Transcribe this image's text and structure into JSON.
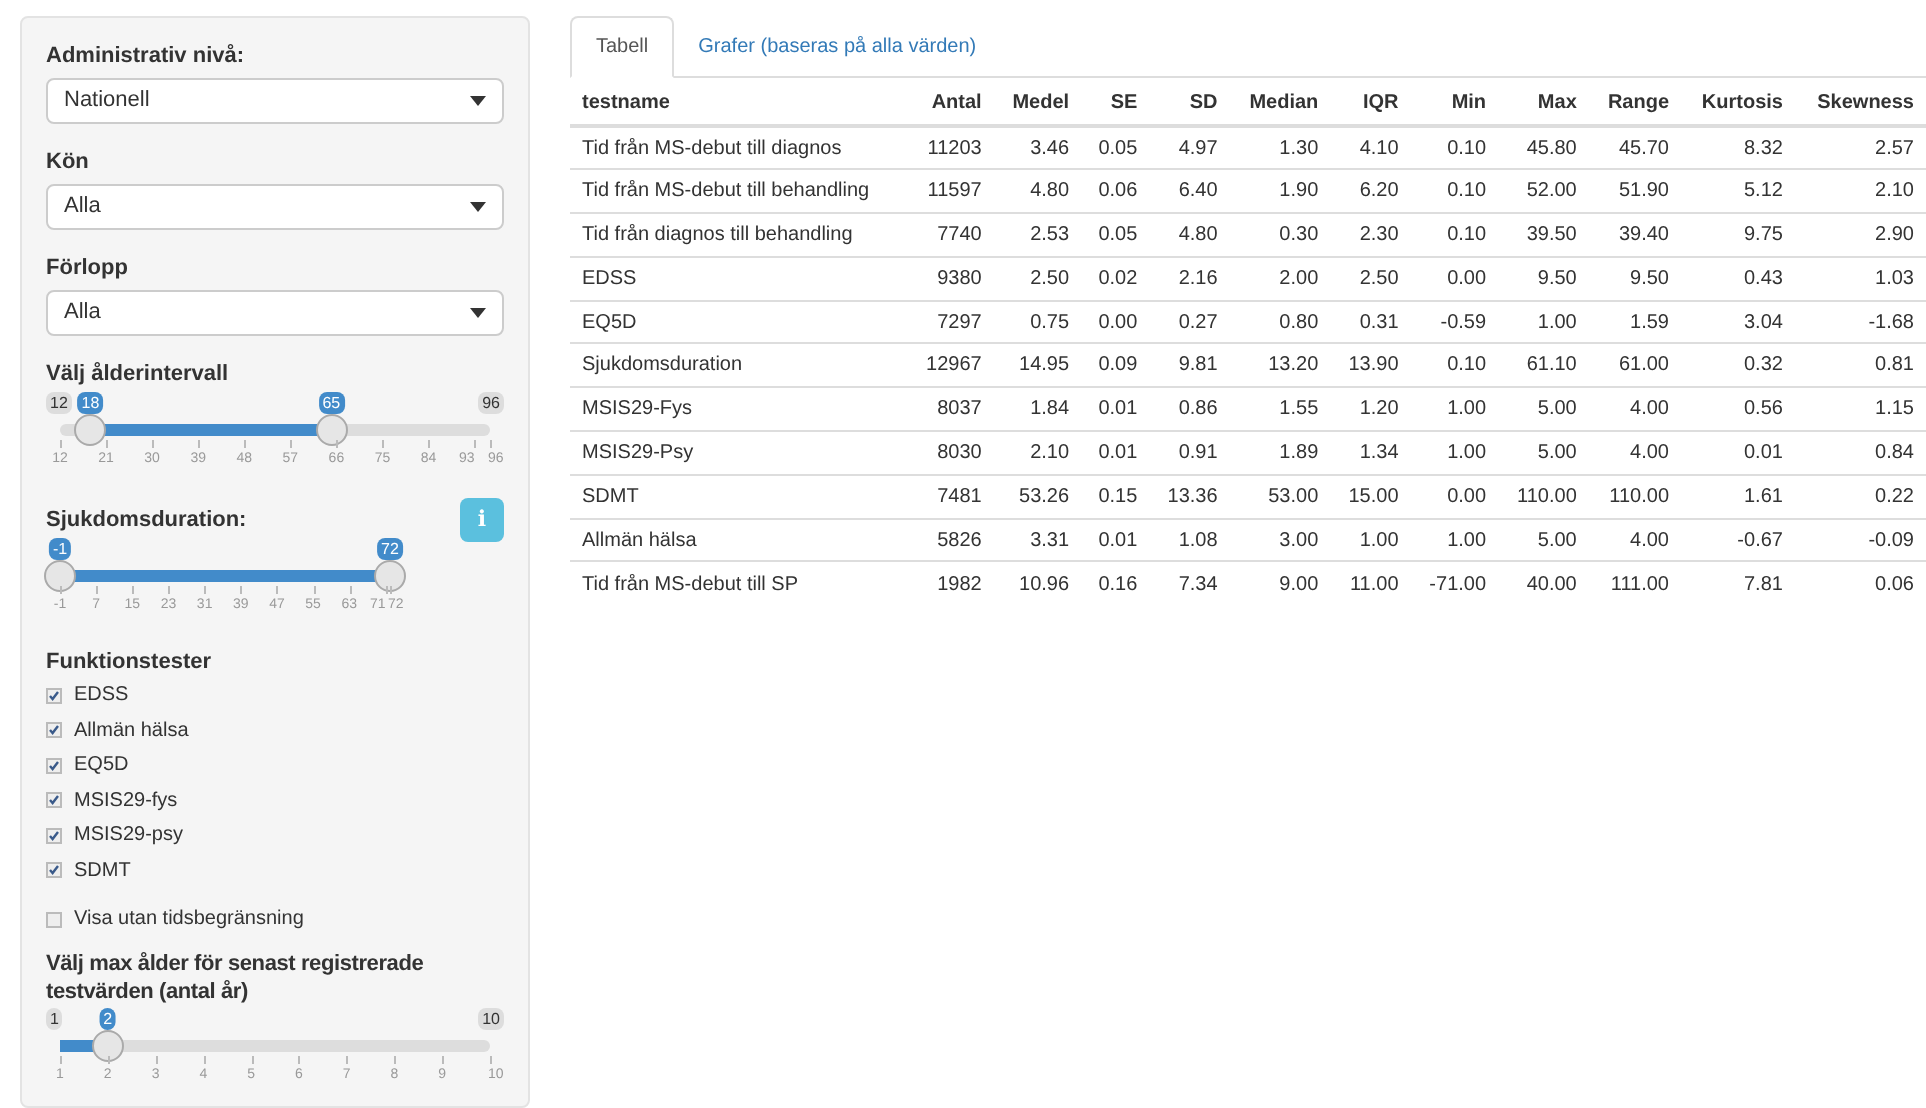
{
  "sidebar": {
    "selects": [
      {
        "label": "Administrativ nivå:",
        "value": "Nationell"
      },
      {
        "label": "Kön",
        "value": "Alla"
      },
      {
        "label": "Förlopp",
        "value": "Alla"
      }
    ],
    "age_slider": {
      "label": "Välj ålderintervall",
      "min": "12",
      "max": "96",
      "thumbs": [
        {
          "value": "18",
          "level": 0.071
        },
        {
          "value": "65",
          "level": 0.631
        }
      ],
      "ticks": [
        "12",
        "21",
        "30",
        "39",
        "48",
        "57",
        "66",
        "75",
        "84",
        "93",
        "96"
      ]
    },
    "duration_slider": {
      "label": "Sjukdomsduration:",
      "thumbs": [
        {
          "value": "-1",
          "level": 0
        },
        {
          "value": "72",
          "level": 1
        }
      ],
      "ticks": [
        "-1",
        "7",
        "15",
        "23",
        "31",
        "39",
        "47",
        "55",
        "63",
        "71",
        "72"
      ]
    },
    "info_button": {
      "label": "i"
    },
    "checks_title": "Funktionstester",
    "checks": [
      {
        "label": "EDSS",
        "checked": true
      },
      {
        "label": "Allmän hälsa",
        "checked": true
      },
      {
        "label": "EQ5D",
        "checked": true
      },
      {
        "label": "MSIS29-fys",
        "checked": true
      },
      {
        "label": "MSIS29-psy",
        "checked": true
      },
      {
        "label": "SDMT",
        "checked": true
      }
    ],
    "no_time_limit": {
      "label": "Visa utan tidsbegränsning",
      "checked": false
    },
    "max_age_slider": {
      "label": "Välj max ålder för senast registrerade testvärden (antal år)",
      "min": "1",
      "max": "10",
      "thumbs": [
        {
          "value": "2",
          "level": 0.111
        }
      ],
      "ticks": [
        "1",
        "2",
        "3",
        "4",
        "5",
        "6",
        "7",
        "8",
        "9",
        "10"
      ]
    }
  },
  "tabs": [
    {
      "label": "Tabell",
      "selected": true
    },
    {
      "label": "Grafer (baseras på alla värden)",
      "selected": false
    }
  ],
  "table": {
    "columns": [
      "testname",
      "Antal",
      "Medel",
      "SE",
      "SD",
      "Median",
      "IQR",
      "Min",
      "Max",
      "Range",
      "Kurtosis",
      "Skewness"
    ],
    "rows": [
      [
        "Tid från MS-debut till diagnos",
        "11203",
        "3.46",
        "0.05",
        "4.97",
        "1.30",
        "4.10",
        "0.10",
        "45.80",
        "45.70",
        "8.32",
        "2.57"
      ],
      [
        "Tid från MS-debut till behandling",
        "11597",
        "4.80",
        "0.06",
        "6.40",
        "1.90",
        "6.20",
        "0.10",
        "52.00",
        "51.90",
        "5.12",
        "2.10"
      ],
      [
        "Tid från diagnos till behandling",
        "7740",
        "2.53",
        "0.05",
        "4.80",
        "0.30",
        "2.30",
        "0.10",
        "39.50",
        "39.40",
        "9.75",
        "2.90"
      ],
      [
        "EDSS",
        "9380",
        "2.50",
        "0.02",
        "2.16",
        "2.00",
        "2.50",
        "0.00",
        "9.50",
        "9.50",
        "0.43",
        "1.03"
      ],
      [
        "EQ5D",
        "7297",
        "0.75",
        "0.00",
        "0.27",
        "0.80",
        "0.31",
        "-0.59",
        "1.00",
        "1.59",
        "3.04",
        "-1.68"
      ],
      [
        "Sjukdomsduration",
        "12967",
        "14.95",
        "0.09",
        "9.81",
        "13.20",
        "13.90",
        "0.10",
        "61.10",
        "61.00",
        "0.32",
        "0.81"
      ],
      [
        "MSIS29-Fys",
        "8037",
        "1.84",
        "0.01",
        "0.86",
        "1.55",
        "1.20",
        "1.00",
        "5.00",
        "4.00",
        "0.56",
        "1.15"
      ],
      [
        "MSIS29-Psy",
        "8030",
        "2.10",
        "0.01",
        "0.91",
        "1.89",
        "1.34",
        "1.00",
        "5.00",
        "4.00",
        "0.01",
        "0.84"
      ],
      [
        "SDMT",
        "7481",
        "53.26",
        "0.15",
        "13.36",
        "53.00",
        "15.00",
        "0.00",
        "110.00",
        "110.00",
        "1.61",
        "0.22"
      ],
      [
        "Allmän hälsa",
        "5826",
        "3.31",
        "0.01",
        "1.08",
        "3.00",
        "1.00",
        "1.00",
        "5.00",
        "4.00",
        "-0.67",
        "-0.09"
      ],
      [
        "Tid från MS-debut till SP",
        "1982",
        "10.96",
        "0.16",
        "7.34",
        "9.00",
        "11.00",
        "-71.00",
        "40.00",
        "111.00",
        "7.81",
        "0.06"
      ]
    ]
  }
}
